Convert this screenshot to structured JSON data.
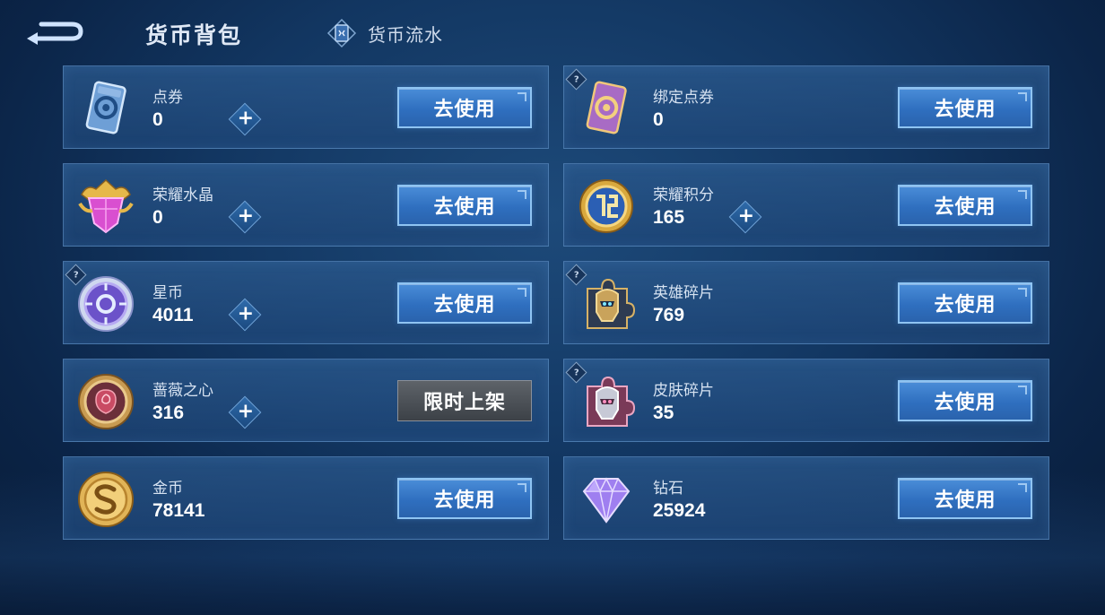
{
  "header": {
    "title": "货币背包",
    "flow_label": "货币流水"
  },
  "actions": {
    "use_label": "去使用",
    "limited_label": "限时上架"
  },
  "currencies": [
    {
      "name": "点券",
      "amount": "0",
      "plus": true,
      "help": false,
      "action": "use",
      "icon": "voucher-icon"
    },
    {
      "name": "绑定点券",
      "amount": "0",
      "plus": false,
      "help": true,
      "action": "use",
      "icon": "bound-voucher-icon"
    },
    {
      "name": "荣耀水晶",
      "amount": "0",
      "plus": true,
      "help": false,
      "action": "use",
      "icon": "glory-crystal-icon"
    },
    {
      "name": "荣耀积分",
      "amount": "165",
      "plus": true,
      "help": false,
      "action": "use",
      "icon": "glory-points-icon"
    },
    {
      "name": "星币",
      "amount": "4011",
      "plus": true,
      "help": true,
      "action": "use",
      "icon": "star-coin-icon"
    },
    {
      "name": "英雄碎片",
      "amount": "769",
      "plus": false,
      "help": true,
      "action": "use",
      "icon": "hero-fragment-icon"
    },
    {
      "name": "蔷薇之心",
      "amount": "316",
      "plus": true,
      "help": false,
      "action": "limited",
      "icon": "rose-heart-icon"
    },
    {
      "name": "皮肤碎片",
      "amount": "35",
      "plus": false,
      "help": true,
      "action": "use",
      "icon": "skin-fragment-icon"
    },
    {
      "name": "金币",
      "amount": "78141",
      "plus": false,
      "help": false,
      "action": "use",
      "icon": "gold-coin-icon"
    },
    {
      "name": "钻石",
      "amount": "25924",
      "plus": false,
      "help": false,
      "action": "use",
      "icon": "diamond-icon"
    }
  ]
}
